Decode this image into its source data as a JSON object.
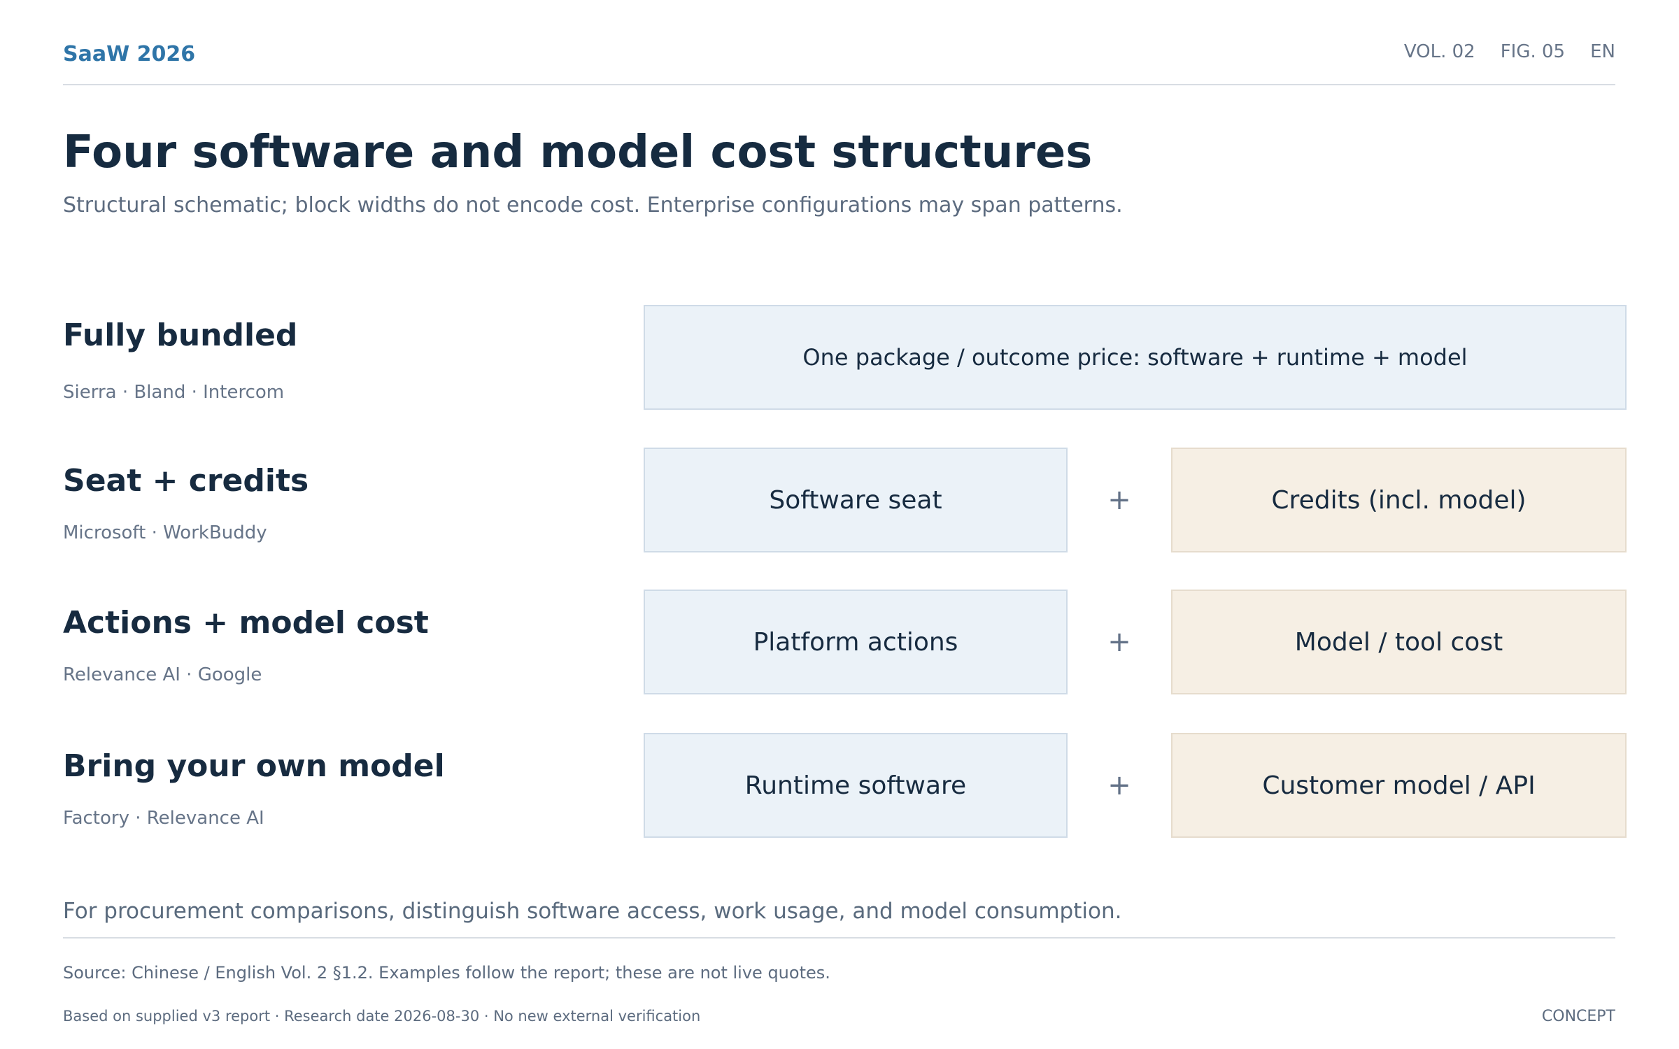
{
  "header": {
    "brand": "SaaW 2026",
    "volume": "VOL. 02",
    "figure": "FIG. 05",
    "language": "EN"
  },
  "title": "Four software and model cost structures",
  "subtitle": "Structural schematic; block widths do not encode cost. Enterprise configurations may span patterns.",
  "rows": [
    {
      "label": "Fully bundled",
      "examples": "Sierra · Bland · Intercom",
      "bundle": "One package / outcome price: software + runtime + model"
    },
    {
      "label": "Seat + credits",
      "examples": "Microsoft · WorkBuddy",
      "left": "Software seat",
      "operator": "+",
      "right": "Credits (incl. model)"
    },
    {
      "label": "Actions + model cost",
      "examples": "Relevance AI · Google",
      "left": "Platform actions",
      "operator": "+",
      "right": "Model / tool cost"
    },
    {
      "label": "Bring your own model",
      "examples": "Factory · Relevance AI",
      "left": "Runtime software",
      "operator": "+",
      "right": "Customer model / API"
    }
  ],
  "note": "For procurement comparisons, distinguish software access, work usage, and model consumption.",
  "footer": {
    "source": "Source: Chinese / English Vol. 2 §1.2. Examples follow the report; these are not live quotes.",
    "basis": "Based on supplied v3 report · Research date 2026-08-30 · No new external verification",
    "status": "CONCEPT"
  },
  "colors": {
    "brand": "#2f75a8",
    "software_block": "#ebf2f8",
    "model_block": "#f6efe4",
    "text": "#172b40",
    "muted_text": "#5c6b7f"
  }
}
